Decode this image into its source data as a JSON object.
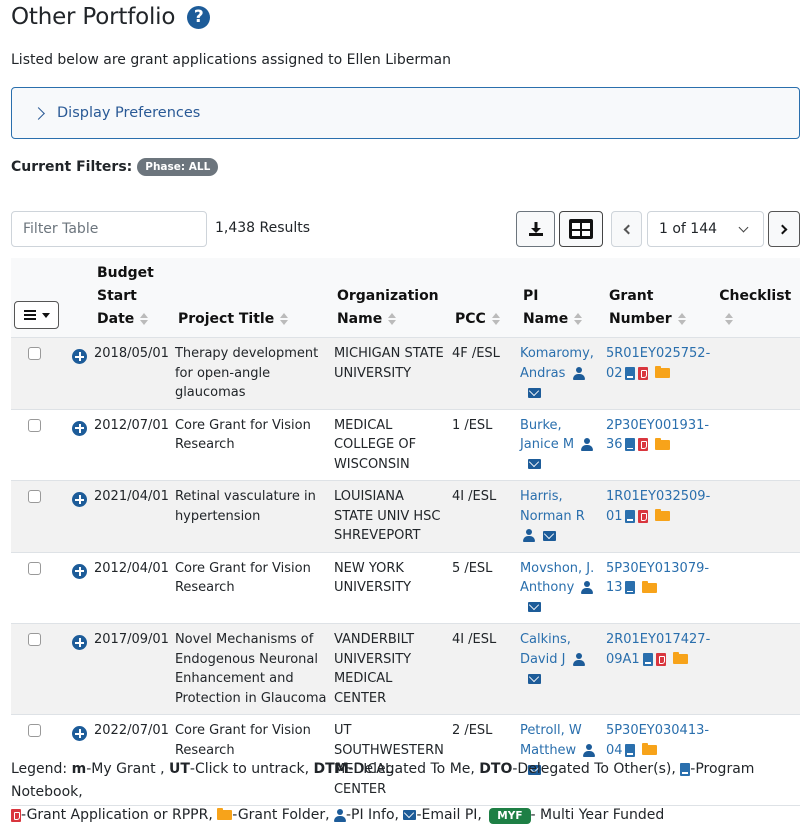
{
  "header": {
    "title": "Other Portfolio",
    "help_icon": "question-circle-icon",
    "subtitle": "Listed below are grant applications assigned to Ellen Liberman"
  },
  "display_preferences": {
    "label": "Display Preferences",
    "icon": "chevron-right-icon"
  },
  "filters": {
    "label": "Current Filters:",
    "badges": [
      "Phase: ALL"
    ]
  },
  "toolbar": {
    "filter_placeholder": "Filter Table",
    "filter_value": "",
    "results": "1,438 Results",
    "download_icon": "download-icon",
    "table_view_icon": "table-grid-icon",
    "prev_icon": "chevron-left-icon",
    "page_select": "1 of 144",
    "next_icon": "chevron-right-icon"
  },
  "table": {
    "column_menu_icon": "hamburger-menu-icon",
    "columns": [
      {
        "label": "Budget Start Date",
        "lines": [
          "Budget",
          "Start",
          "Date"
        ]
      },
      {
        "label": "Project Title"
      },
      {
        "label": "Organization Name",
        "lines": [
          "Organization",
          "Name"
        ]
      },
      {
        "label": "PCC"
      },
      {
        "label": "PI Name",
        "lines": [
          "PI",
          "Name"
        ]
      },
      {
        "label": "Grant Number",
        "lines": [
          "Grant",
          "Number"
        ]
      },
      {
        "label": "Checklist"
      }
    ],
    "rows": [
      {
        "date": "2018/05/01",
        "title": "Therapy development for open-angle glaucomas",
        "org": "MICHIGAN STATE UNIVERSITY",
        "pcc": "4F /ESL",
        "pi": "Komaromy, Andras",
        "grant": "5R01EY025752-02",
        "grant_lines": [
          "5R01EY025752-",
          "02"
        ],
        "icons": [
          "notebook",
          "pdf",
          "folder"
        ],
        "checklist": ""
      },
      {
        "date": "2012/07/01",
        "title": "Core Grant for Vision Research",
        "org": "MEDICAL COLLEGE OF WISCONSIN",
        "pcc": "1 /ESL",
        "pi": "Burke, Janice M",
        "grant": "2P30EY001931-36",
        "grant_lines": [
          "2P30EY001931-",
          "36"
        ],
        "icons": [
          "notebook",
          "pdf",
          "folder"
        ],
        "checklist": ""
      },
      {
        "date": "2021/04/01",
        "title": "Retinal vasculature in hypertension",
        "org": "LOUISIANA STATE UNIV HSC SHREVEPORT",
        "pcc": "4I /ESL",
        "pi": "Harris, Norman R",
        "grant": "1R01EY032509-01",
        "grant_lines": [
          "1R01EY032509-",
          "01"
        ],
        "icons": [
          "notebook",
          "pdf",
          "folder"
        ],
        "checklist": ""
      },
      {
        "date": "2012/04/01",
        "title": "Core Grant for Vision Research",
        "org": "NEW YORK UNIVERSITY",
        "pcc": "5 /ESL",
        "pi": "Movshon, J. Anthony",
        "grant": "5P30EY013079-13",
        "grant_lines": [
          "5P30EY013079-",
          "13"
        ],
        "icons": [
          "notebook",
          "folder"
        ],
        "checklist": ""
      },
      {
        "date": "2017/09/01",
        "title": "Novel Mechanisms of Endogenous Neuronal Enhancement and Protection in Glaucoma",
        "org": "VANDERBILT UNIVERSITY MEDICAL CENTER",
        "pcc": "4I /ESL",
        "pi": "Calkins, David J",
        "grant": "2R01EY017427-09A1",
        "grant_lines": [
          "2R01EY017427-",
          "09A1"
        ],
        "icons": [
          "notebook",
          "pdf",
          "folder"
        ],
        "checklist": ""
      },
      {
        "date": "2022/07/01",
        "title": "Core Grant for Vision Research",
        "org": "UT SOUTHWESTERN MEDICAL CENTER",
        "pcc": "2 /ESL",
        "pi": "Petroll, W Matthew",
        "grant": "5P30EY030413-04",
        "grant_lines": [
          "5P30EY030413-",
          "04"
        ],
        "icons": [
          "notebook",
          "folder"
        ],
        "checklist": ""
      }
    ]
  },
  "legend": {
    "prefix": "Legend:",
    "items": [
      {
        "key": "m",
        "text": "-My Grant ,"
      },
      {
        "key": "UT",
        "text": "-Click to untrack,"
      },
      {
        "key": "DTM",
        "text": "-Delegated To Me,"
      },
      {
        "key": "DTO",
        "text": "-Delegated To Other(s),"
      },
      {
        "icon": "notebook-icon",
        "text": "-Program Notebook,"
      },
      {
        "icon": "pdf-icon",
        "text": "-Grant Application or RPPR,"
      },
      {
        "icon": "folder-icon",
        "text": "-Grant Folder,"
      },
      {
        "icon": "user-icon",
        "text": "-PI Info,"
      },
      {
        "icon": "envelope-icon",
        "text": "-Email PI,"
      },
      {
        "badge": "MYF",
        "text": "- Multi Year Funded"
      }
    ]
  },
  "colors": {
    "link": "#2a6fad",
    "icon_blue": "#1d5c99",
    "pdf_red": "#d9363e",
    "folder_orange": "#f7a31a",
    "myf_green": "#1e7f45",
    "badge_gray": "#6c757d",
    "row_stripe": "#f2f2f2"
  }
}
